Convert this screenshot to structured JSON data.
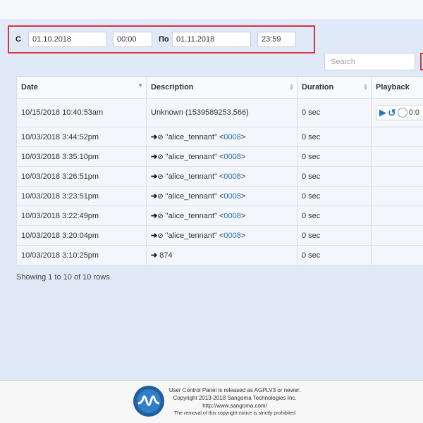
{
  "filter": {
    "from_label": "С",
    "from_date": "01.10.2018",
    "from_time": "00:00",
    "to_label": "По",
    "to_date": "01.11.2018",
    "to_time": "23:59"
  },
  "search": {
    "placeholder": "Search"
  },
  "table": {
    "columns": [
      "Date",
      "Description",
      "Duration",
      "Playback"
    ],
    "rows": [
      {
        "date": "10/15/2018 10:40:53am",
        "description": "Unknown (1539589253.566)",
        "duration": "0 sec",
        "player_time": "0:0"
      },
      {
        "date": "10/03/2018 3:44:52pm",
        "caller": "\"alice_tennant\" ",
        "ext_open": "<",
        "ext": "0008",
        "ext_close": ">",
        "duration": "0 sec"
      },
      {
        "date": "10/03/2018 3:35:10pm",
        "caller": "\"alice_tennant\" ",
        "ext_open": "<",
        "ext": "0008",
        "ext_close": ">",
        "duration": "0 sec"
      },
      {
        "date": "10/03/2018 3:26:51pm",
        "caller": "\"alice_tennant\" ",
        "ext_open": "<",
        "ext": "0008",
        "ext_close": ">",
        "duration": "0 sec"
      },
      {
        "date": "10/03/2018 3:23:51pm",
        "caller": "\"alice_tennant\" ",
        "ext_open": "<",
        "ext": "0008",
        "ext_close": ">",
        "duration": "0 sec"
      },
      {
        "date": "10/03/2018 3:22:49pm",
        "caller": "\"alice_tennant\" ",
        "ext_open": "<",
        "ext": "0008",
        "ext_close": ">",
        "duration": "0 sec"
      },
      {
        "date": "10/03/2018 3:20:04pm",
        "caller": "\"alice_tennant\" ",
        "ext_open": "<",
        "ext": "0008",
        "ext_close": ">",
        "duration": "0 sec"
      },
      {
        "date": "10/03/2018 3:10:25pm",
        "number": "874",
        "duration": "0 sec"
      }
    ]
  },
  "pagination": {
    "info": "Showing 1 to 10 of 10 rows"
  },
  "footer": {
    "line1": "User Control Panel is released as AGPLV3 or newer.",
    "line2": "Copyright 2013-2018 Sangoma Technologies Inc.",
    "line3": "http://www.sangoma.com/",
    "line4": "The removal of this copyright notice is strictly prohibited"
  },
  "colors": {
    "highlight": "#d9343a",
    "link": "#2a6fb5",
    "background": "#dfe9f7"
  }
}
